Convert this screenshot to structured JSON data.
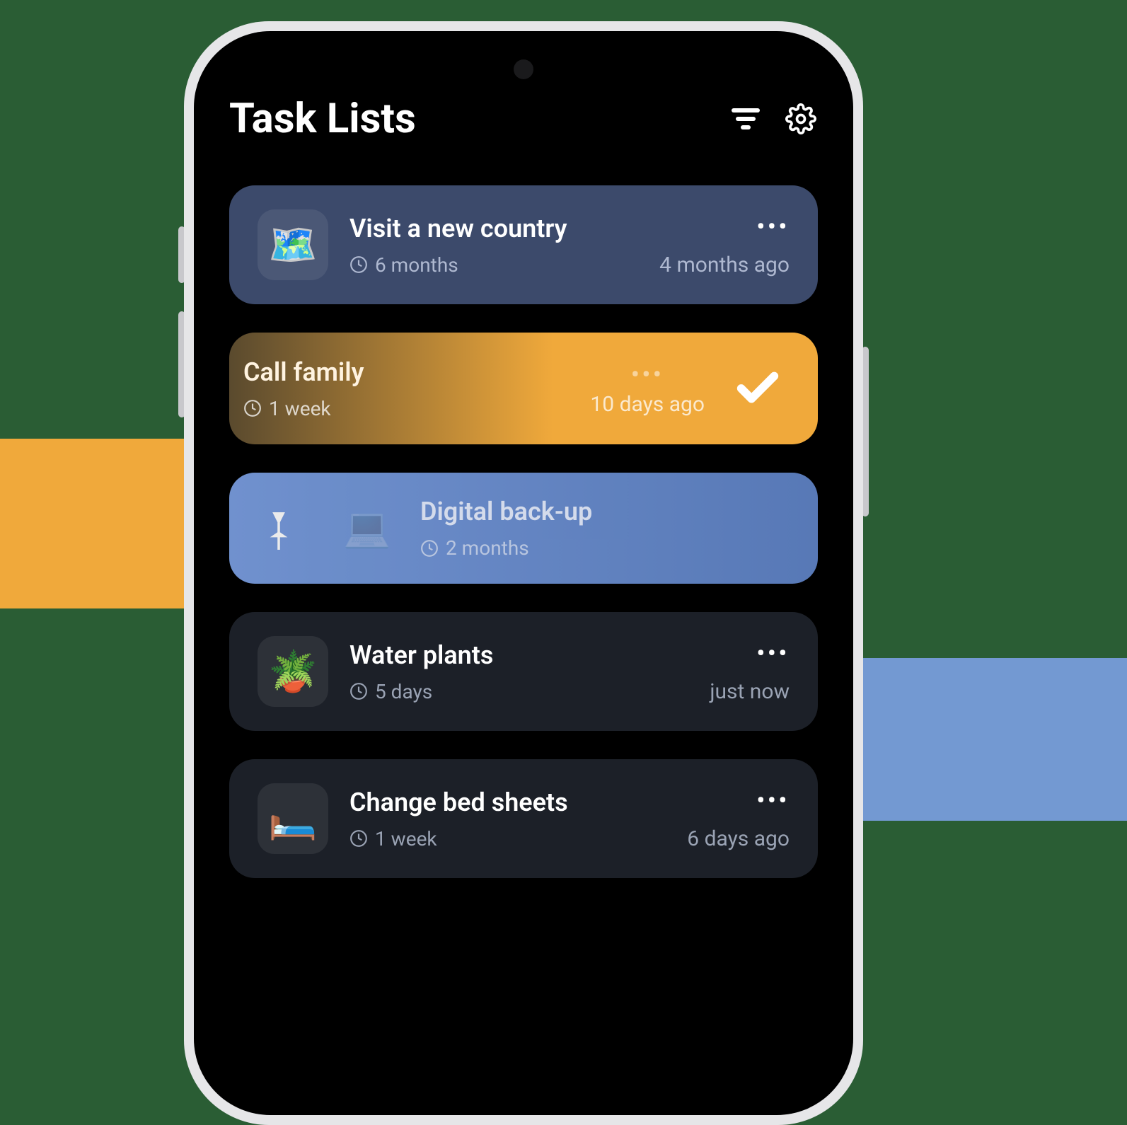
{
  "header": {
    "title": "Task Lists"
  },
  "tasks": [
    {
      "emoji": "🗺️",
      "title": "Visit a new country",
      "interval": "6 months",
      "ago": "4 months ago",
      "style": "blue"
    },
    {
      "title": "Call family",
      "interval": "1 week",
      "ago": "10 days ago",
      "style": "orange",
      "completed": true
    },
    {
      "title": "Digital back-up",
      "interval": "2 months",
      "style": "light",
      "pinned": true,
      "icon": "laptop"
    },
    {
      "emoji": "🪴",
      "title": "Water plants",
      "interval": "5 days",
      "ago": "just now",
      "style": "dark"
    },
    {
      "emoji": "🛏️",
      "title": "Change bed sheets",
      "interval": "1 week",
      "ago": "6 days ago",
      "style": "dark"
    }
  ]
}
